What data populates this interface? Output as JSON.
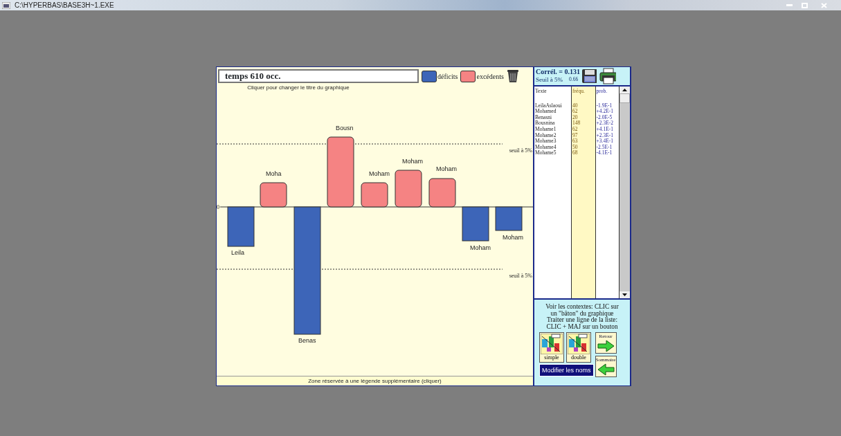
{
  "window": {
    "title": "C:\\HYPERBAS\\BASE3H~1.EXE"
  },
  "chart": {
    "title": "temps  610 occ.",
    "hint": "Cliquer pour changer le titre du graphique",
    "legend": [
      {
        "label": "déficits",
        "color": "#3d65b8"
      },
      {
        "label": "excédents",
        "color": "#f58383"
      }
    ],
    "zero_label": "0",
    "threshold_labels": [
      "seuil à 5%",
      "seuil à 5%"
    ],
    "bars": [
      {
        "label": "Leila",
        "kind": "deficit"
      },
      {
        "label": "Moha",
        "kind": "excess"
      },
      {
        "label": "Benas",
        "kind": "deficit"
      },
      {
        "label": "Bousn",
        "kind": "excess"
      },
      {
        "label": "Moham",
        "kind": "excess"
      },
      {
        "label": "Moham",
        "kind": "excess"
      },
      {
        "label": "Moham",
        "kind": "excess"
      },
      {
        "label": "Moham",
        "kind": "deficit"
      },
      {
        "label": "Moham",
        "kind": "deficit"
      }
    ],
    "footer": "Zone réservée à une légende supplémentaire (cliquer)"
  },
  "stats": {
    "correl": "Corrél. = 0.131",
    "seuil_label": "Seuil à 5%",
    "seuil_value": "0.66"
  },
  "table": {
    "columns": [
      "Texte",
      "fréqu.",
      "prob."
    ],
    "rows": [
      [
        "LeilaAslaoui",
        "40",
        "-1.9E-1"
      ],
      [
        "Mohamed",
        "62",
        "+4.2E-1"
      ],
      [
        "Benasni",
        "20",
        "-2.0E-5"
      ],
      [
        "Bousnina",
        "148",
        "+2.3E-2"
      ],
      [
        "Mohame1",
        "62",
        "+4.1E-1"
      ],
      [
        "Mohame2",
        "97",
        "+2.3E-1"
      ],
      [
        "Mohame3",
        "63",
        "+3.4E-1"
      ],
      [
        "Mohame4",
        "50",
        "-2.5E-1"
      ],
      [
        "Mohame5",
        "68",
        "-4.1E-1"
      ]
    ]
  },
  "help_lines": [
    "Voir les contextes: CLIC sur",
    "un \"bâton\" du graphique",
    "Traiter une ligne de la liste:",
    "CLIC + MAJ sur un bouton"
  ],
  "buttons": [
    {
      "label": "simple",
      "kind": "chart"
    },
    {
      "label": "double",
      "kind": "chart"
    },
    {
      "label": "Retour",
      "kind": "forward"
    },
    {
      "label": "Sommaire",
      "kind": "back"
    }
  ],
  "modify_button": "Modifier les noms"
}
